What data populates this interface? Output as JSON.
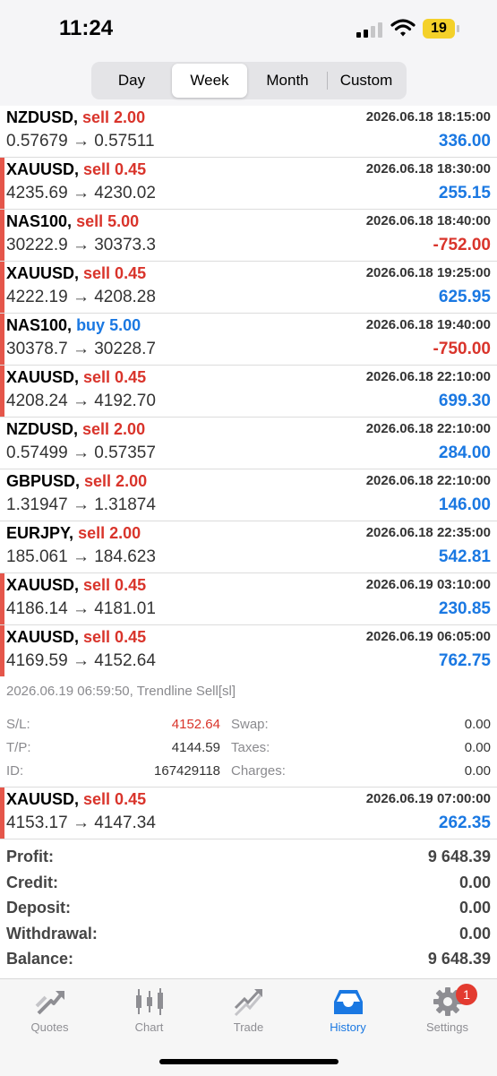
{
  "status": {
    "time": "11:24",
    "battery": "19"
  },
  "period_tabs": [
    {
      "label": "Day",
      "active": false
    },
    {
      "label": "Week",
      "active": true
    },
    {
      "label": "Month",
      "active": false
    },
    {
      "label": "Custom",
      "active": false
    }
  ],
  "deals": [
    {
      "symbol": "NZDUSD,",
      "side": "sell",
      "side_label": "sell 2.00",
      "time": "2026.06.18 18:15:00",
      "prices": "0.57679 → 0.57511",
      "profit": "336.00",
      "marked": false,
      "negative": false
    },
    {
      "symbol": "XAUUSD,",
      "side": "sell",
      "side_label": "sell 0.45",
      "time": "2026.06.18 18:30:00",
      "prices": "4235.69 → 4230.02",
      "profit": "255.15",
      "marked": true,
      "negative": false
    },
    {
      "symbol": "NAS100,",
      "side": "sell",
      "side_label": "sell 5.00",
      "time": "2026.06.18 18:40:00",
      "prices": "30222.9 → 30373.3",
      "profit": "-752.00",
      "marked": true,
      "negative": true
    },
    {
      "symbol": "XAUUSD,",
      "side": "sell",
      "side_label": "sell 0.45",
      "time": "2026.06.18 19:25:00",
      "prices": "4222.19 → 4208.28",
      "profit": "625.95",
      "marked": true,
      "negative": false
    },
    {
      "symbol": "NAS100,",
      "side": "buy",
      "side_label": "buy 5.00",
      "time": "2026.06.18 19:40:00",
      "prices": "30378.7 → 30228.7",
      "profit": "-750.00",
      "marked": true,
      "negative": true
    },
    {
      "symbol": "XAUUSD,",
      "side": "sell",
      "side_label": "sell 0.45",
      "time": "2026.06.18 22:10:00",
      "prices": "4208.24 → 4192.70",
      "profit": "699.30",
      "marked": true,
      "negative": false
    },
    {
      "symbol": "NZDUSD,",
      "side": "sell",
      "side_label": "sell 2.00",
      "time": "2026.06.18 22:10:00",
      "prices": "0.57499 → 0.57357",
      "profit": "284.00",
      "marked": false,
      "negative": false
    },
    {
      "symbol": "GBPUSD,",
      "side": "sell",
      "side_label": "sell 2.00",
      "time": "2026.06.18 22:10:00",
      "prices": "1.31947 → 1.31874",
      "profit": "146.00",
      "marked": false,
      "negative": false
    },
    {
      "symbol": "EURJPY,",
      "side": "sell",
      "side_label": "sell 2.00",
      "time": "2026.06.18 22:35:00",
      "prices": "185.061 → 184.623",
      "profit": "542.81",
      "marked": false,
      "negative": false
    },
    {
      "symbol": "XAUUSD,",
      "side": "sell",
      "side_label": "sell 0.45",
      "time": "2026.06.19 03:10:00",
      "prices": "4186.14 → 4181.01",
      "profit": "230.85",
      "marked": true,
      "negative": false
    },
    {
      "symbol": "XAUUSD,",
      "side": "sell",
      "side_label": "sell 0.45",
      "time": "2026.06.19 06:05:00",
      "prices": "4169.59 → 4152.64",
      "profit": "762.75",
      "marked": true,
      "negative": false
    }
  ],
  "detail": {
    "comment": "2026.06.19 06:59:50, Trendline Sell[sl]",
    "sl_label": "S/L:",
    "sl_value": "4152.64",
    "tp_label": "T/P:",
    "tp_value": "4144.59",
    "id_label": "ID:",
    "id_value": "167429118",
    "swap_label": "Swap:",
    "swap_value": "0.00",
    "taxes_label": "Taxes:",
    "taxes_value": "0.00",
    "charges_label": "Charges:",
    "charges_value": "0.00"
  },
  "last_deal": {
    "symbol": "XAUUSD,",
    "side": "sell",
    "side_label": "sell 0.45",
    "time": "2026.06.19 07:00:00",
    "prices": "4153.17 → 4147.34",
    "profit": "262.35",
    "marked": true,
    "negative": false
  },
  "summary": [
    {
      "label": "Profit:",
      "value": "9 648.39"
    },
    {
      "label": "Credit:",
      "value": "0.00"
    },
    {
      "label": "Deposit:",
      "value": "0.00"
    },
    {
      "label": "Withdrawal:",
      "value": "0.00"
    },
    {
      "label": "Balance:",
      "value": "9 648.39"
    }
  ],
  "tabbar": [
    {
      "label": "Quotes",
      "icon": "quotes-icon",
      "active": false
    },
    {
      "label": "Chart",
      "icon": "chart-icon",
      "active": false
    },
    {
      "label": "Trade",
      "icon": "trade-icon",
      "active": false
    },
    {
      "label": "History",
      "icon": "history-icon",
      "active": true
    },
    {
      "label": "Settings",
      "icon": "settings-icon",
      "active": false
    }
  ],
  "settings_badge": "1",
  "colors": {
    "sell": "#d9342b",
    "buy": "#1a78e2",
    "profit_positive": "#1a78e2",
    "profit_negative": "#d9342b",
    "marker": "#e5564a",
    "active_tab": "#1a78e2"
  }
}
